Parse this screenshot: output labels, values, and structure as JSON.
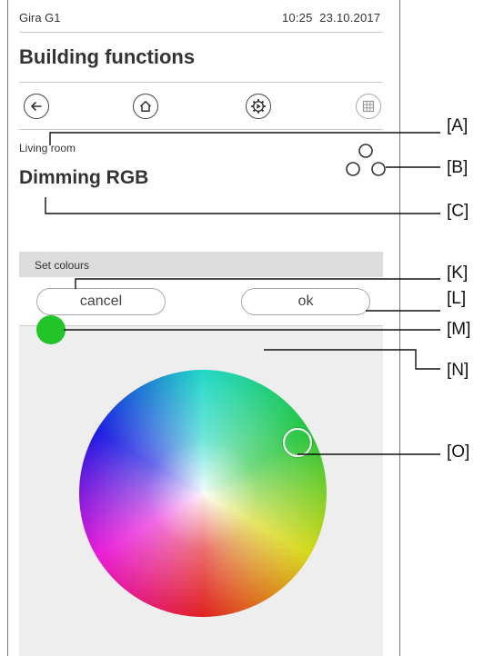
{
  "status_bar": {
    "device_name": "Gira G1",
    "time": "10:25",
    "date": "23.10.2017"
  },
  "header": {
    "title": "Building functions"
  },
  "nav": {
    "icons": [
      "back-arrow-icon",
      "home-icon",
      "settings-gear-icon",
      "grid-icon"
    ]
  },
  "function": {
    "room": "Living room",
    "name": "Dimming RGB",
    "icon": "rgb-circles-icon"
  },
  "colour_panel": {
    "header_label": "Set colours",
    "cancel_label": "cancel",
    "ok_label": "ok",
    "selected_colour": "#22c42a"
  },
  "callouts": {
    "A": "[A]",
    "B": "[B]",
    "C": "[C]",
    "K": "[K]",
    "L": "[L]",
    "M": "[M]",
    "N": "[N]",
    "O": "[O]"
  },
  "colors": {
    "panel_bg": "#eeeeee",
    "panel_header_bg": "#dcdcdc",
    "frame_line": "#777777"
  }
}
